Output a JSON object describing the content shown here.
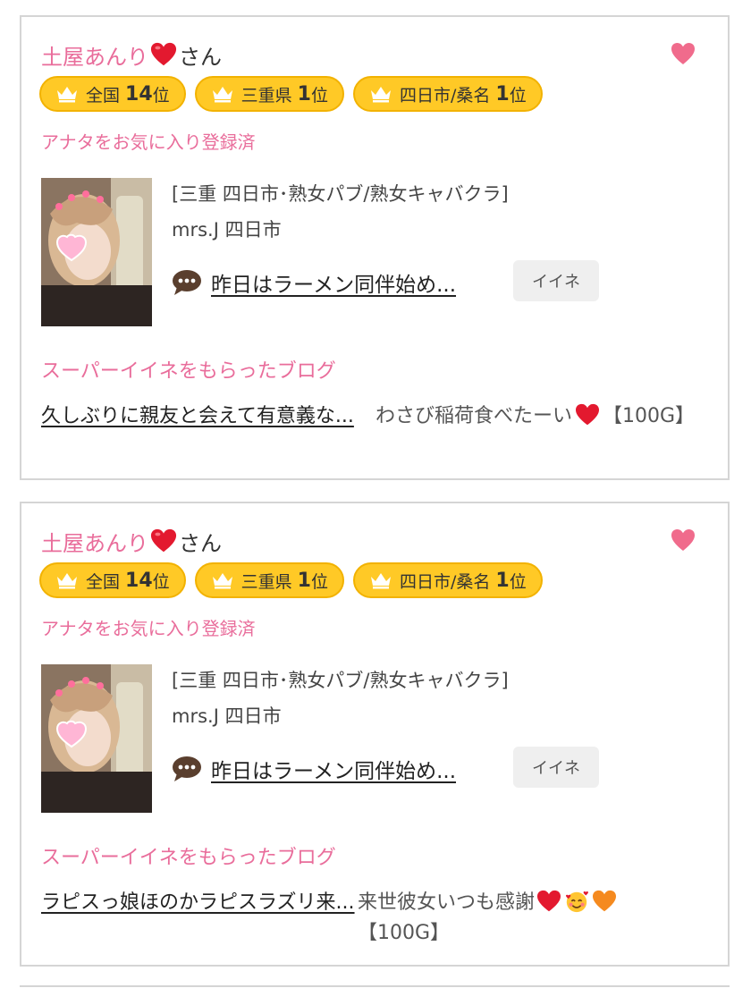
{
  "colors": {
    "pink": "#e96d9b",
    "gold": "#ffc926",
    "border": "#d5d5d5"
  },
  "cards": [
    {
      "name": "土屋あんり",
      "name_emoji": "red-heart",
      "honorific": "さん",
      "favorite_icon": "heart-icon",
      "badges": [
        {
          "icon": "crown-icon",
          "label": "全国",
          "rank": "14",
          "suffix": "位"
        },
        {
          "icon": "crown-icon",
          "label": "三重県",
          "rank": "1",
          "suffix": "位"
        },
        {
          "icon": "crown-icon",
          "label": "四日市/桑名",
          "rank": "1",
          "suffix": "位"
        }
      ],
      "favorite_status": "アナタをお気に入り登録済",
      "shop_category": "[三重 四日市･熟女パブ/熟女キャバクラ]",
      "shop_name": "mrs.J 四日市",
      "blog_title": "昨日はラーメン同伴始め...",
      "iine_label": "イイネ",
      "super_heading": "スーパーイイネをもらったブログ",
      "super_blog_link": "久しぶりに親友と会えて有意義な...",
      "super_comment": "わさび稲荷食べたーい",
      "super_comment_emojis": [
        "red-heart"
      ],
      "super_points": "【100G】"
    },
    {
      "name": "土屋あんり",
      "name_emoji": "red-heart",
      "honorific": "さん",
      "favorite_icon": "heart-icon",
      "badges": [
        {
          "icon": "crown-icon",
          "label": "全国",
          "rank": "14",
          "suffix": "位"
        },
        {
          "icon": "crown-icon",
          "label": "三重県",
          "rank": "1",
          "suffix": "位"
        },
        {
          "icon": "crown-icon",
          "label": "四日市/桑名",
          "rank": "1",
          "suffix": "位"
        }
      ],
      "favorite_status": "アナタをお気に入り登録済",
      "shop_category": "[三重 四日市･熟女パブ/熟女キャバクラ]",
      "shop_name": "mrs.J 四日市",
      "blog_title": "昨日はラーメン同伴始め...",
      "iine_label": "イイネ",
      "super_heading": "スーパーイイネをもらったブログ",
      "super_blog_link": "ラピスっ娘ほのかラピスラズリ来...",
      "super_comment": "来世彼女いつも感謝",
      "super_comment_emojis": [
        "red-heart",
        "smiling-face-with-hearts",
        "orange-heart"
      ],
      "super_points": "【100G】"
    }
  ]
}
